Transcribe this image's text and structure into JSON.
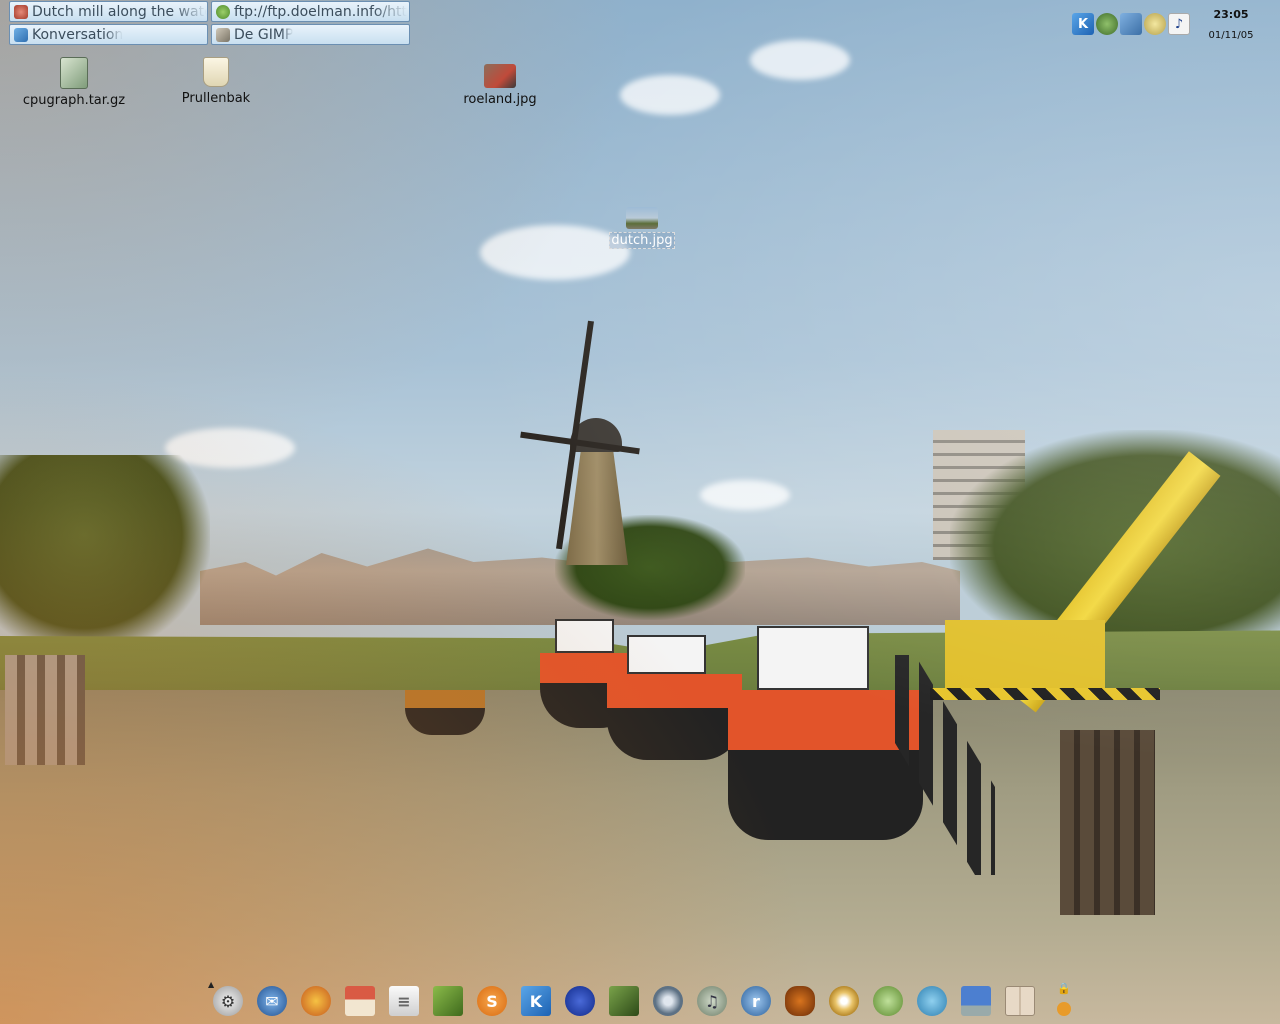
{
  "taskbar": {
    "windows": [
      {
        "label": "Dutch mill along the wate",
        "icon": "photo-viewer-icon"
      },
      {
        "label": "ftp://ftp.doelman.info/htt",
        "icon": "konqueror-icon"
      },
      {
        "label": "Konversation",
        "icon": "konversation-icon"
      },
      {
        "label": "De GIMP",
        "icon": "gimp-icon"
      }
    ]
  },
  "tray": {
    "icons": [
      "kde-icon",
      "user-icon",
      "network-icon",
      "klipper-icon",
      "kmix-icon"
    ],
    "clock": {
      "time": "23:05",
      "date": "01/11/05"
    }
  },
  "desktop": {
    "icons": [
      {
        "label": "cpugraph.tar.gz",
        "icon": "archive-icon"
      },
      {
        "label": "Prullenbak",
        "icon": "trash-icon"
      },
      {
        "label": "roeland.jpg",
        "icon": "image-icon"
      },
      {
        "label": "dutch.jpg",
        "icon": "image-icon",
        "selected": true
      }
    ]
  },
  "panel": {
    "launchers": [
      {
        "name": "kde-menu",
        "icon": "gear-icon"
      },
      {
        "name": "thunderbird",
        "icon": "mail-icon"
      },
      {
        "name": "firefox",
        "icon": "browser-icon"
      },
      {
        "name": "home",
        "icon": "home-icon"
      },
      {
        "name": "kpdf",
        "icon": "document-icon"
      },
      {
        "name": "kate",
        "icon": "book-icon"
      },
      {
        "name": "skype",
        "icon": "skype-icon"
      },
      {
        "name": "kde-control",
        "icon": "kde-icon"
      },
      {
        "name": "gimp",
        "icon": "paint-icon"
      },
      {
        "name": "terminal",
        "icon": "terminal-icon"
      },
      {
        "name": "amarok",
        "icon": "media-icon"
      },
      {
        "name": "sound",
        "icon": "music-icon"
      },
      {
        "name": "realplayer",
        "icon": "player-icon"
      },
      {
        "name": "coffee",
        "icon": "coffee-icon"
      },
      {
        "name": "k3b",
        "icon": "disc-icon"
      },
      {
        "name": "gaim",
        "icon": "chat-icon"
      },
      {
        "name": "msn",
        "icon": "messenger-icon"
      },
      {
        "name": "remote-desktop",
        "icon": "monitor-icon"
      },
      {
        "name": "desktop-pager",
        "icon": "pager-icon"
      }
    ]
  }
}
